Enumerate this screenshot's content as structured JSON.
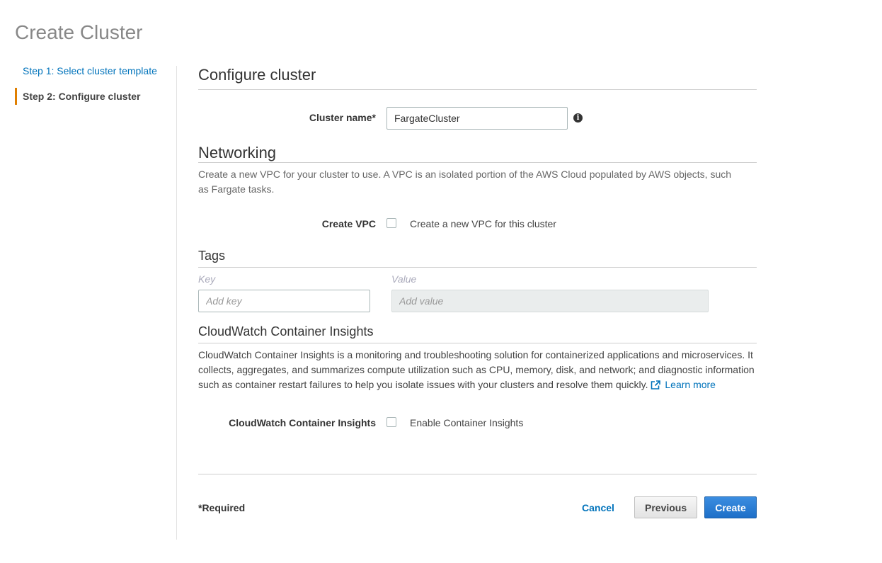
{
  "page": {
    "title": "Create Cluster"
  },
  "wizard": {
    "steps": [
      {
        "label": "Step 1: Select cluster template",
        "active": false
      },
      {
        "label": "Step 2: Configure cluster",
        "active": true
      }
    ]
  },
  "configure": {
    "heading": "Configure cluster",
    "cluster_name_label": "Cluster name*",
    "cluster_name_value": "FargateCluster",
    "info_icon": "info-icon"
  },
  "networking": {
    "heading": "Networking",
    "description": "Create a new VPC for your cluster to use. A VPC is an isolated portion of the AWS Cloud populated by AWS objects, such as Fargate tasks.",
    "create_vpc_label": "Create VPC",
    "create_vpc_checkbox_text": "Create a new VPC for this cluster",
    "create_vpc_checked": false
  },
  "tags": {
    "heading": "Tags",
    "key_label": "Key",
    "value_label": "Value",
    "key_placeholder": "Add key",
    "value_placeholder": "Add value"
  },
  "insights": {
    "heading": "CloudWatch Container Insights",
    "description": "CloudWatch Container Insights is a monitoring and troubleshooting solution for containerized applications and microservices. It collects, aggregates, and summarizes compute utilization such as CPU, memory, disk, and network; and diagnostic information such as container restart failures to help you isolate issues with your clusters and resolve them quickly.",
    "learn_more": "Learn more",
    "field_label": "CloudWatch Container Insights",
    "checkbox_text": "Enable Container Insights",
    "checked": false
  },
  "footer": {
    "required_note": "*Required",
    "cancel": "Cancel",
    "previous": "Previous",
    "create": "Create"
  },
  "colors": {
    "link": "#0073bb",
    "active_step_accent": "#e07f00",
    "primary_button": "#1e6fc8"
  }
}
